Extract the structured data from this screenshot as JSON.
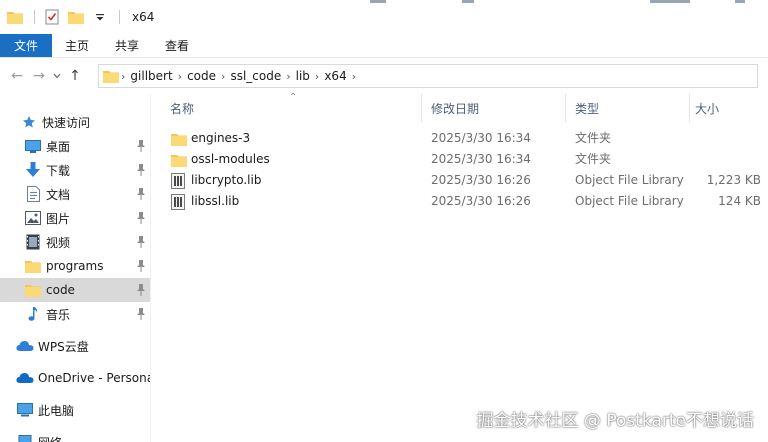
{
  "window": {
    "title": "x64"
  },
  "ribbon": {
    "tabs": [
      "文件",
      "主页",
      "共享",
      "查看"
    ]
  },
  "address": {
    "path": [
      "gillbert",
      "code",
      "ssl_code",
      "lib",
      "x64"
    ]
  },
  "sidebar": {
    "quick_access": "快速访问",
    "items": [
      {
        "label": "桌面",
        "icon": "desktop-icon",
        "pinned": true
      },
      {
        "label": "下载",
        "icon": "download-icon",
        "pinned": true
      },
      {
        "label": "文档",
        "icon": "document-icon",
        "pinned": true
      },
      {
        "label": "图片",
        "icon": "picture-icon",
        "pinned": true
      },
      {
        "label": "视频",
        "icon": "video-icon",
        "pinned": true
      },
      {
        "label": "programs",
        "icon": "folder-icon",
        "pinned": true
      },
      {
        "label": "code",
        "icon": "folder-icon",
        "pinned": true,
        "selected": true
      },
      {
        "label": "音乐",
        "icon": "music-icon",
        "pinned": true
      }
    ],
    "wps": "WPS云盘",
    "onedrive": "OneDrive - Persona",
    "thispc": "此电脑",
    "network": "网络"
  },
  "columns": {
    "name": "名称",
    "date": "修改日期",
    "type": "类型",
    "size": "大小"
  },
  "files": [
    {
      "name": "engines-3",
      "date": "2025/3/30 16:34",
      "type": "文件夹",
      "size": "",
      "icon": "folder-icon"
    },
    {
      "name": "ossl-modules",
      "date": "2025/3/30 16:34",
      "type": "文件夹",
      "size": "",
      "icon": "folder-icon"
    },
    {
      "name": "libcrypto.lib",
      "date": "2025/3/30 16:26",
      "type": "Object File Library",
      "size": "1,223 KB",
      "icon": "lib-file-icon"
    },
    {
      "name": "libssl.lib",
      "date": "2025/3/30 16:26",
      "type": "Object File Library",
      "size": "124 KB",
      "icon": "lib-file-icon"
    }
  ],
  "watermark": "掘金技术社区 @ Postkarte不想说话",
  "colors": {
    "accent": "#1a6fc4",
    "folder": "#f5c751",
    "selected": "#d9d9d9",
    "header_text": "#4c607a"
  }
}
